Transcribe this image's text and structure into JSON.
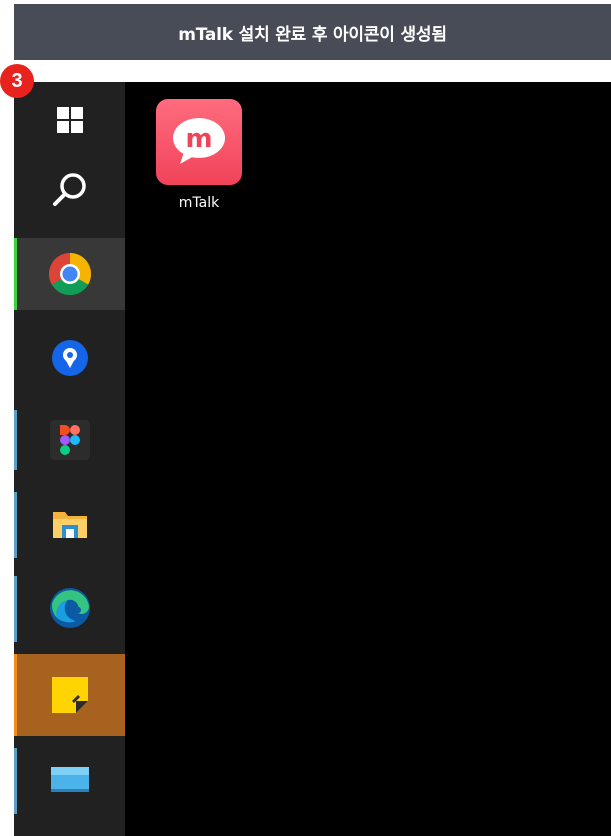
{
  "header": {
    "title": "mTalk 설치 완료 후 아이콘이 생성됨"
  },
  "step": {
    "number": "3"
  },
  "desktop": {
    "icons": [
      {
        "label": "mTalk",
        "icon": "mtalk-app-icon",
        "color": "#f1435a"
      }
    ]
  },
  "taskbar": {
    "items": [
      {
        "name": "start",
        "icon": "windows-logo-icon"
      },
      {
        "name": "search",
        "icon": "search-icon"
      },
      {
        "name": "chrome",
        "icon": "chrome-icon",
        "active": true,
        "indicator_color": "#3bd43b"
      },
      {
        "name": "location-app",
        "icon": "location-pin-icon"
      },
      {
        "name": "figma",
        "icon": "figma-icon"
      },
      {
        "name": "file-explorer",
        "icon": "folder-icon"
      },
      {
        "name": "edge",
        "icon": "edge-icon"
      },
      {
        "name": "sticky-notes",
        "icon": "sticky-note-icon",
        "highlight_color": "#a7621f"
      },
      {
        "name": "desktop-app",
        "icon": "monitor-icon"
      }
    ]
  },
  "colors": {
    "header_bg": "#474c56",
    "taskbar_bg": "#212121",
    "desktop_bg": "#000000",
    "badge": "#e8231d"
  }
}
